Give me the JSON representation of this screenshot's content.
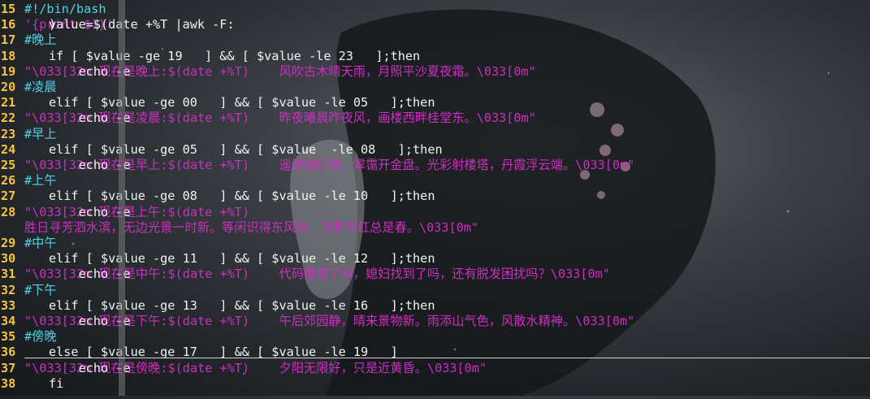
{
  "editor": {
    "lines": [
      {
        "num": "15",
        "parts": [
          {
            "t": "#!/bin/bash",
            "c": "comment"
          }
        ]
      },
      {
        "num": "16",
        "parts": [
          {
            "t": "value=$(date +%T |awk -F: ",
            "c": "code"
          },
          {
            "t": "'{print $1}'",
            "c": "str"
          },
          {
            "t": ")",
            "c": "code"
          }
        ]
      },
      {
        "num": "17",
        "parts": [
          {
            "t": "#晚上",
            "c": "comment"
          }
        ]
      },
      {
        "num": "18",
        "parts": [
          {
            "t": "if [ $value -ge 19   ] && [ $value -le 23   ];then",
            "c": "code"
          }
        ]
      },
      {
        "num": "19",
        "parts": [
          {
            "t": "    echo -e ",
            "c": "code"
          },
          {
            "t": "\"\\033[32m 现在是晚上:$(date +%T)    风吹古木晴天雨，月照平沙夏夜霜。\\033[0m\"",
            "c": "str"
          }
        ]
      },
      {
        "num": "20",
        "parts": [
          {
            "t": "#凌晨",
            "c": "comment"
          }
        ]
      },
      {
        "num": "21",
        "parts": [
          {
            "t": "elif [ $value -ge 00   ] && [ $value -le 05   ];then",
            "c": "code"
          }
        ]
      },
      {
        "num": "22",
        "parts": [
          {
            "t": "    echo -e ",
            "c": "code"
          },
          {
            "t": "\"\\033[32m 现在是凌晨:$(date +%T)    昨夜曦晨昨夜风，画楼西畔桂堂东。\\033[0m\"",
            "c": "str"
          }
        ]
      },
      {
        "num": "23",
        "parts": [
          {
            "t": "#早上",
            "c": "comment"
          }
        ]
      },
      {
        "num": "24",
        "parts": [
          {
            "t": "elif [ $value -ge 05   ] && [ $value  -le 08   ];then",
            "c": "code"
          }
        ]
      },
      {
        "num": "25",
        "parts": [
          {
            "t": "    echo -e ",
            "c": "code"
          },
          {
            "t": "\"\\033[32m 现在是早上:$(date +%T)    遥波蛰红鳞，翠霭开金盘。光彩射楼塔，丹霞浮云端。\\033[0m\"",
            "c": "str"
          }
        ]
      },
      {
        "num": "26",
        "parts": [
          {
            "t": "#上午",
            "c": "comment"
          }
        ]
      },
      {
        "num": "27",
        "parts": [
          {
            "t": "elif [ $value -ge 08   ] && [ $value -le 10   ];then",
            "c": "code"
          }
        ]
      },
      {
        "num": "28",
        "parts": [
          {
            "t": "    echo -e ",
            "c": "code"
          },
          {
            "t": "\"\\033[32m 现在是上午:$(date +%T)",
            "c": "str"
          }
        ]
      },
      {
        "num": "",
        "parts": [
          {
            "t": "胜日寻芳泗水滨，无边光景一时新。等闲识得东风面，万紫千红总是春。\\033[0m\"",
            "c": "str"
          }
        ]
      },
      {
        "num": "29",
        "parts": [
          {
            "t": "#中午",
            "c": "comment"
          }
        ]
      },
      {
        "num": "30",
        "parts": [
          {
            "t": "elif [ $value -ge 11   ] && [ $value -le 12   ];then",
            "c": "code"
          }
        ]
      },
      {
        "num": "31",
        "parts": [
          {
            "t": "    echo -e ",
            "c": "code"
          },
          {
            "t": "\"\\033[32m 现在是中午:$(date +%T)    代码撸完了吗，媳妇找到了吗，还有脱发困扰吗？\\033[0m\"",
            "c": "str"
          }
        ]
      },
      {
        "num": "32",
        "parts": [
          {
            "t": "#下午",
            "c": "comment"
          }
        ]
      },
      {
        "num": "33",
        "parts": [
          {
            "t": "elif [ $value -ge 13   ] && [ $value -le 16   ];then",
            "c": "code"
          }
        ]
      },
      {
        "num": "34",
        "parts": [
          {
            "t": "    echo -e ",
            "c": "code"
          },
          {
            "t": "\"\\033[32m 现在是下午:$(date +%T)    午后郊园静，晴来景物新。雨添山气色，风散水精神。\\033[0m\"",
            "c": "str"
          }
        ]
      },
      {
        "num": "35",
        "parts": [
          {
            "t": "#傍晚",
            "c": "comment"
          }
        ]
      },
      {
        "num": "36",
        "parts": [
          {
            "t": "else [ $value -ge 17   ] && [ $value -le 19   ]",
            "c": "code"
          }
        ]
      },
      {
        "num": "37",
        "parts": [
          {
            "t": "    echo -e ",
            "c": "code"
          },
          {
            "t": "\"\\033[32m 现在是傍晚:$(date +%T)    夕阳无限好，只是近黄昏。\\033[0m\"",
            "c": "str"
          }
        ]
      },
      {
        "num": "38",
        "parts": [
          {
            "t": "fi",
            "c": "code"
          }
        ]
      }
    ]
  },
  "colors": {
    "line_number": "#f5c542",
    "comment": "#4fd2e6",
    "string": "#cc2fc0",
    "text": "#f2f2f2"
  }
}
